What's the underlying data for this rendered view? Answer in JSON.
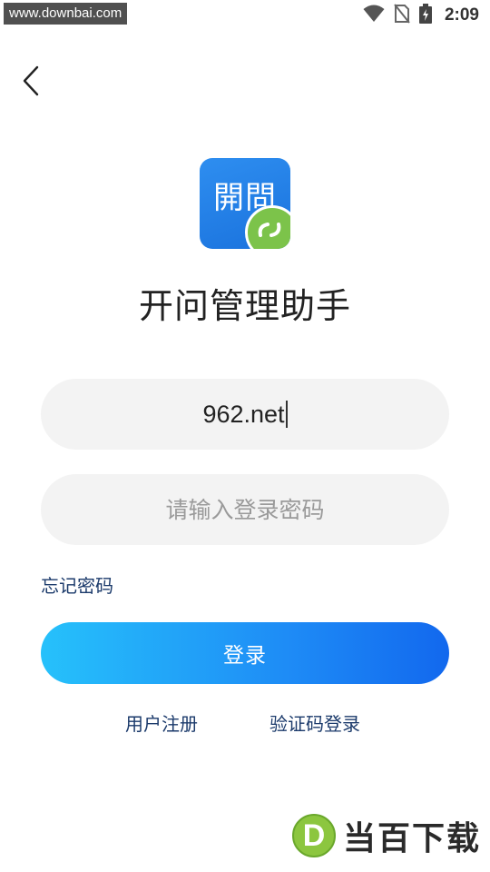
{
  "status_bar": {
    "watermark": "www.downbai.com",
    "time": "2:09",
    "icons": [
      "wifi-icon",
      "no-sim-icon",
      "battery-charging-icon"
    ]
  },
  "header": {
    "back_icon": "chevron-left-icon"
  },
  "app": {
    "logo_text": "開問",
    "logo_badge_icon": "link-icon",
    "title": "开问管理助手",
    "brand_color": "#1a72dd",
    "badge_color": "#7cc34a"
  },
  "form": {
    "account_value": "962.net",
    "password_placeholder": "请输入登录密码",
    "forgot_password": "忘记密码",
    "login_button": "登录",
    "login_gradient": [
      "#26c1fb",
      "#1268ee"
    ]
  },
  "footer_links": {
    "register": "用户注册",
    "sms_login": "验证码登录"
  },
  "watermark_bottom": {
    "logo_letter": "D",
    "text": "当百下载"
  }
}
